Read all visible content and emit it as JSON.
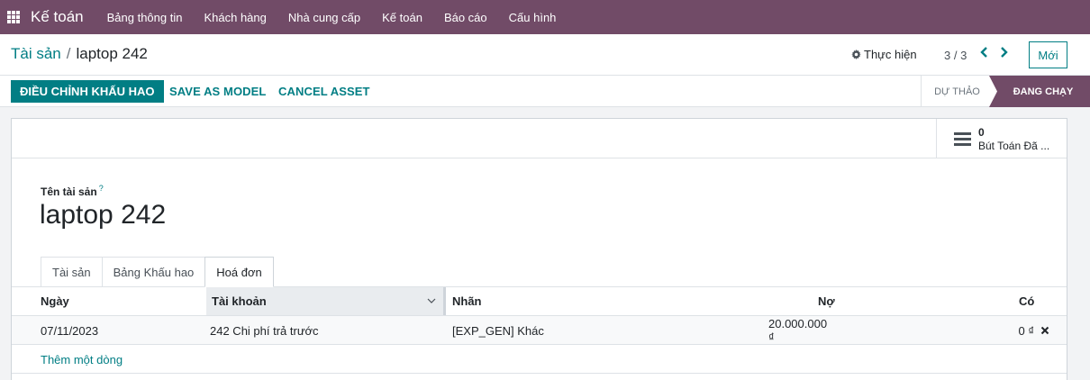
{
  "navbar": {
    "apps_icon": "apps-grid-icon",
    "brand": "Kế toán",
    "menu": [
      "Bảng thông tin",
      "Khách hàng",
      "Nhà cung cấp",
      "Kế toán",
      "Báo cáo",
      "Cấu hình"
    ]
  },
  "control_panel": {
    "breadcrumb_parent": "Tài sản",
    "breadcrumb_separator": "/",
    "breadcrumb_current": "laptop 242",
    "action_menu": "Thực hiện",
    "action_icon": "gear-icon",
    "pager": "3 / 3",
    "new_button": "Mới"
  },
  "statusbar": {
    "primary_button": "ĐIỀU CHỈNH KHẤU HAO",
    "save_as_model": "SAVE AS MODEL",
    "cancel_asset": "CANCEL ASSET",
    "stages": [
      "DỰ THẢO",
      "ĐANG CHẠY"
    ],
    "active_stage": "ĐANG CHẠY"
  },
  "smart_button": {
    "icon": "list-bars-icon",
    "value": "0",
    "label": "Bút Toán Đã ..."
  },
  "form": {
    "name_label": "Tên tài sản",
    "help_mark": "?",
    "asset_name": "laptop 242"
  },
  "tabs": [
    "Tài sản",
    "Bảng Khấu hao",
    "Hoá đơn"
  ],
  "active_tab": "Hoá đơn",
  "table": {
    "headers": [
      "Ngày",
      "Tài khoản",
      "Nhãn",
      "Nợ",
      "Có"
    ],
    "rows": [
      {
        "date": "07/11/2023",
        "account": "242 Chi phí trả trước",
        "label": "[EXP_GEN] Khác",
        "debit": "20.000.000 ₫",
        "credit": "0 ₫"
      }
    ],
    "add_line": "Thêm một dòng"
  },
  "colors": {
    "brand": "#714B67",
    "accent": "#017e84"
  }
}
